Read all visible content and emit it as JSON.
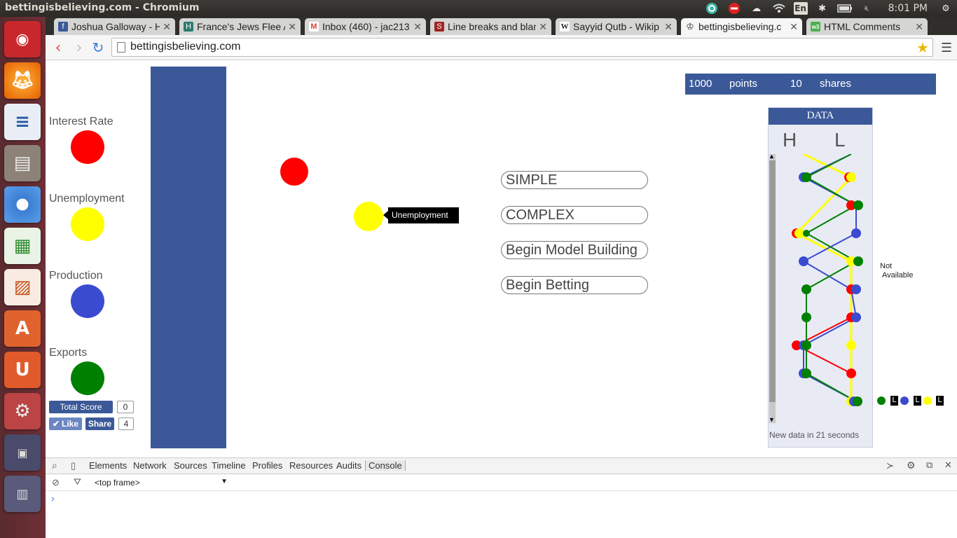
{
  "os": {
    "window_title": "bettingisbelieving.com - Chromium",
    "keyboard": "En",
    "clock": "8:01 PM"
  },
  "tabs": [
    {
      "label": "Joshua Galloway - H",
      "icon": "facebook-icon",
      "color": "#3b5998",
      "glyph": "f"
    },
    {
      "label": "France's Jews Flee A",
      "icon": "h-site-icon",
      "color": "#2e7a6e",
      "glyph": "H"
    },
    {
      "label": "Inbox (460) - jac213",
      "icon": "gmail-icon",
      "color": "#d44638",
      "glyph": "M"
    },
    {
      "label": "Line breaks and blan",
      "icon": "s-site-icon",
      "color": "#a1241f",
      "glyph": "S"
    },
    {
      "label": "Sayyid Qutb - Wikip",
      "icon": "wikipedia-icon",
      "color": "#555555",
      "glyph": "W"
    },
    {
      "label": "bettingisbelieving.c",
      "icon": "crown-icon",
      "color": "#444444",
      "glyph": "♔"
    },
    {
      "label": "HTML Comments",
      "icon": "w3-icon",
      "color": "#4caf50",
      "glyph": "w3"
    }
  ],
  "address": "bettingisbelieving.com",
  "page": {
    "legend": [
      {
        "label": "Interest Rate",
        "color": "#ff0000"
      },
      {
        "label": "Unemployment",
        "color": "#ffff00"
      },
      {
        "label": "Production",
        "color": "#3b4bd0"
      },
      {
        "label": "Exports",
        "color": "#008000"
      }
    ],
    "total_score_label": "Total Score",
    "total_score_value": "0",
    "like_label": "Like",
    "share_label": "Share",
    "share_count": "4",
    "tooltip": "Unemployment",
    "buttons": [
      "SIMPLE",
      "COMPLEX",
      "Begin Model Building",
      "Begin Betting"
    ],
    "score": {
      "points_value": "1000",
      "points_label": "points",
      "shares_value": "10",
      "shares_label": "shares"
    },
    "data_panel": {
      "title": "DATA",
      "col_h": "H",
      "col_l": "L",
      "new_data": "New data in 21 seconds",
      "not_available_1": "Not",
      "not_available_2": "Available",
      "marker_label": "L"
    }
  },
  "devtools": {
    "tabs": [
      "Elements",
      "Network",
      "Sources",
      "Timeline",
      "Profiles",
      "Resources",
      "Audits",
      "Console"
    ],
    "frame": "<top frame>",
    "prompt": "›"
  }
}
